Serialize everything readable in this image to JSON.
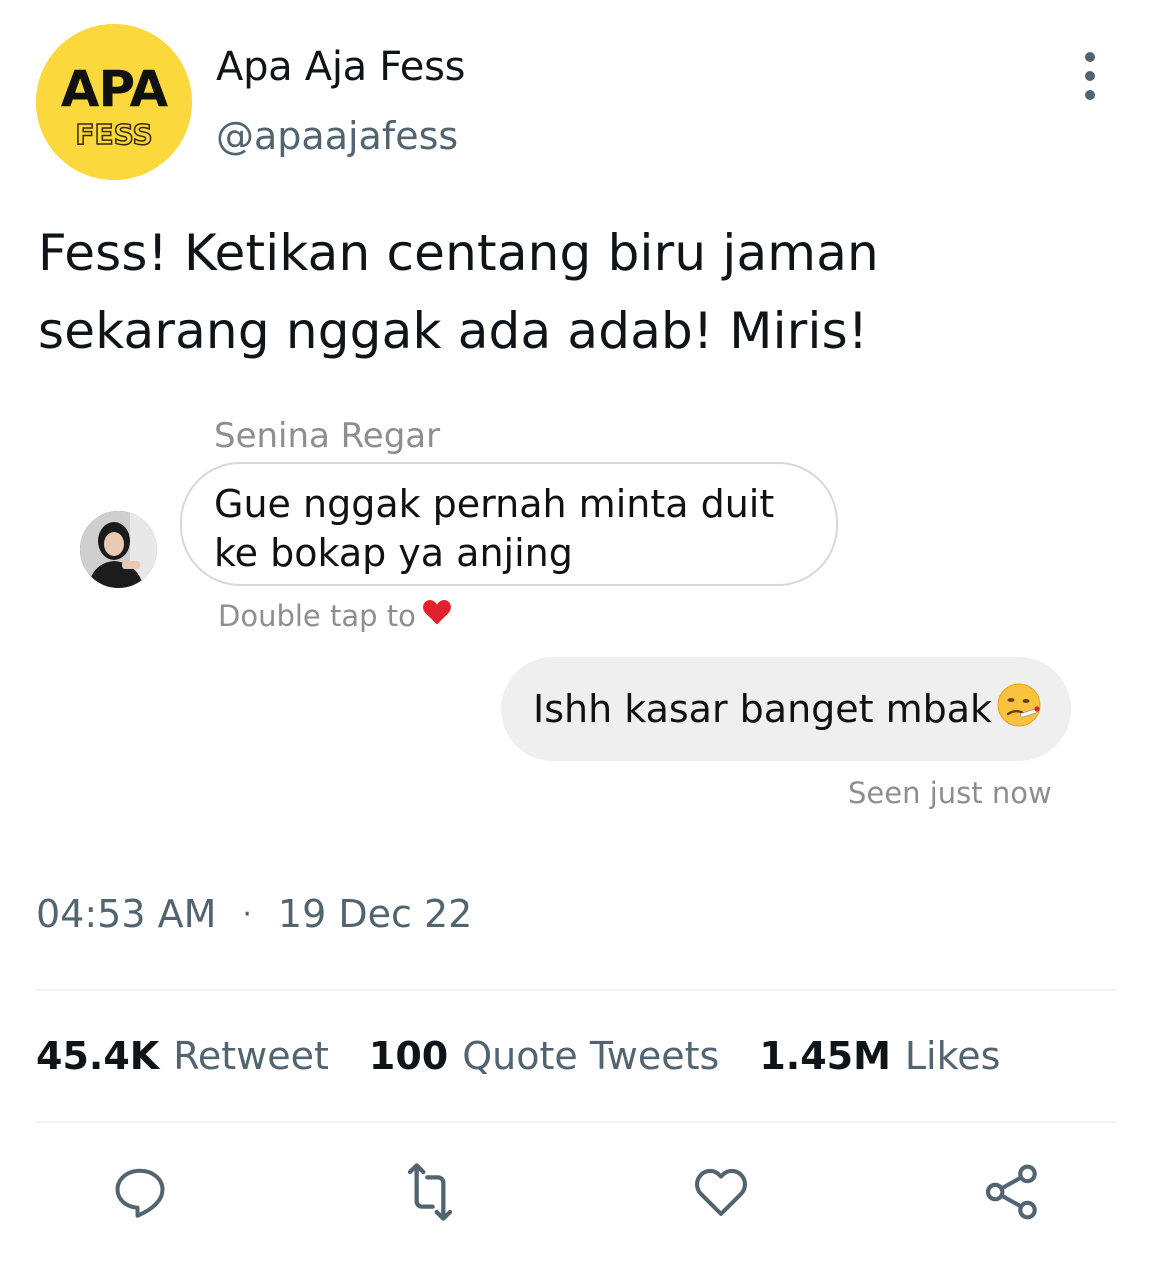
{
  "account": {
    "display_name": "Apa Aja Fess",
    "handle": "@apaajafess",
    "avatar_logo": {
      "top_text": "APA",
      "bottom_text": "FESS",
      "background_color": "#fbd83c"
    }
  },
  "tweet": {
    "text": "Fess! Ketikan centang biru jaman sekarang nggak ada adab! Miris!",
    "time": "04:53 AM",
    "date": "19 Dec 22",
    "separator": "·"
  },
  "chat": {
    "sender_name": "Senina Regar",
    "incoming_message": "Gue nggak pernah minta duit ke bokap ya anjing",
    "double_tap_hint": "Double tap to",
    "double_tap_emoji": "heart-emoji",
    "outgoing_message": "Ishh kasar banget mbak",
    "outgoing_emoji": "face-with-thermometer-emoji",
    "seen_status": "Seen just now"
  },
  "stats": [
    {
      "count": "45.4K",
      "label": "Retweet"
    },
    {
      "count": "100",
      "label": "Quote Tweets"
    },
    {
      "count": "1.45M",
      "label": "Likes"
    }
  ],
  "actions": [
    {
      "icon": "reply-icon"
    },
    {
      "icon": "retweet-icon"
    },
    {
      "icon": "like-icon"
    },
    {
      "icon": "share-icon"
    }
  ],
  "colors": {
    "primary_text": "#0f1419",
    "secondary_text": "#536471",
    "chat_meta_text": "#8e8e8e",
    "outgoing_bubble": "#efefef",
    "divider": "#eff3f4",
    "heart": "#e0245e"
  }
}
